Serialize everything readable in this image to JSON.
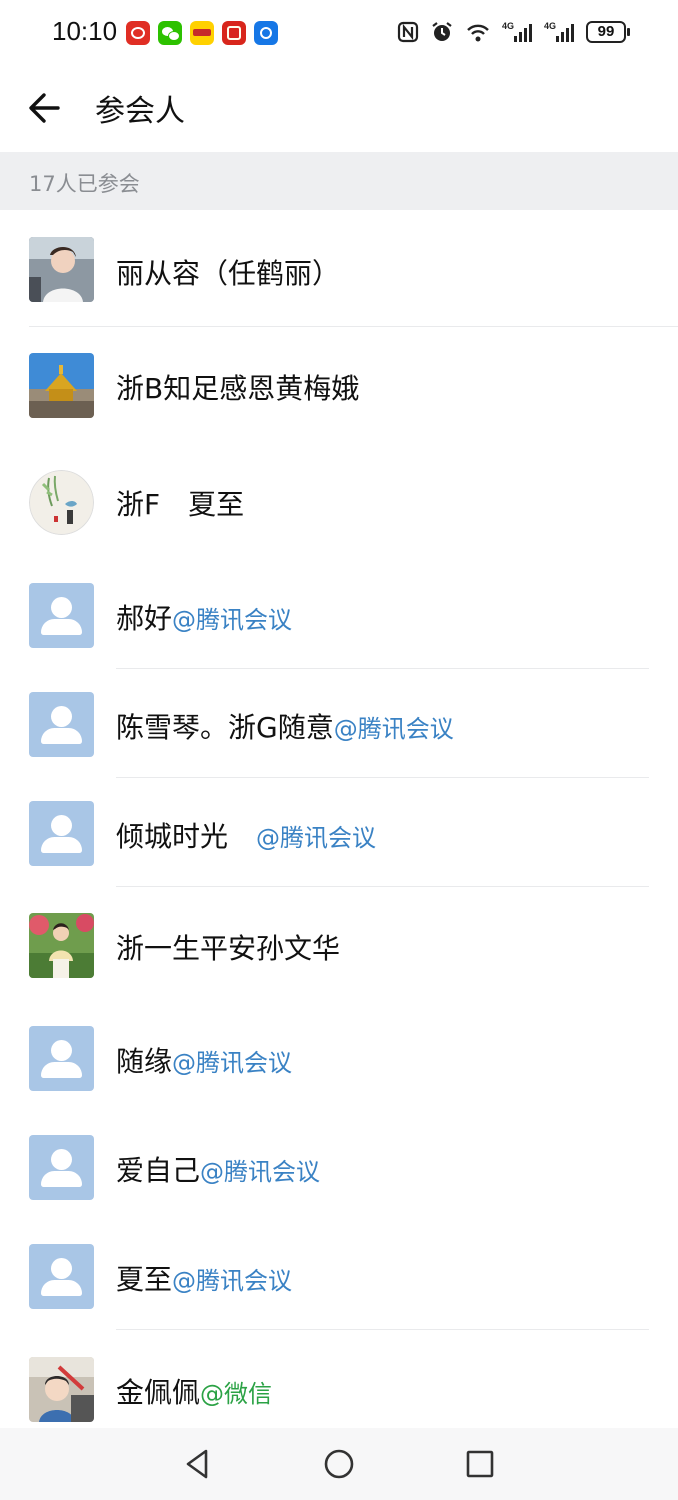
{
  "status_bar": {
    "time": "10:10",
    "battery": "99",
    "notification_icons": [
      "pinduoduo-icon",
      "wechat-icon",
      "meituan-icon",
      "taobao-icon",
      "browser-icon"
    ],
    "system_icons": [
      "nfc-icon",
      "alarm-icon",
      "wifi-icon",
      "signal-4g-icon",
      "signal-4g-icon"
    ]
  },
  "header": {
    "title": "参会人"
  },
  "summary": {
    "count_text": "17人已参会"
  },
  "participants": [
    {
      "name": "丽从容（任鹤丽）",
      "suffix": "",
      "avatar": "photo-woman-car"
    },
    {
      "name": "浙B知足感恩黄梅娥",
      "suffix": "",
      "avatar": "photo-golden-pavilion"
    },
    {
      "name": "浙F　夏至",
      "suffix": "",
      "avatar": "painting-bird-round"
    },
    {
      "name": "郝好",
      "suffix": "@腾讯会议",
      "avatar": "default"
    },
    {
      "name": "陈雪琴。浙G随意",
      "suffix": "@腾讯会议",
      "avatar": "default"
    },
    {
      "name": "倾城时光　",
      "suffix": "@腾讯会议",
      "avatar": "default"
    },
    {
      "name": "浙一生平安孙文华",
      "suffix": "",
      "avatar": "photo-woman-garden"
    },
    {
      "name": "随缘",
      "suffix": "@腾讯会议",
      "avatar": "default"
    },
    {
      "name": "爱自己",
      "suffix": "@腾讯会议",
      "avatar": "default"
    },
    {
      "name": "夏至",
      "suffix": "@腾讯会议",
      "avatar": "default"
    },
    {
      "name": "金佩佩",
      "suffix": "@微信",
      "avatar": "photo-child"
    }
  ],
  "colors": {
    "tencent_meeting_suffix": "#3a82c4",
    "wechat_suffix": "#2ba245",
    "default_avatar": "#a9c6e6",
    "count_bar_bg": "#eeeff1"
  },
  "nav_bar": {
    "buttons": [
      "back-triangle-icon",
      "home-circle-icon",
      "recents-square-icon"
    ]
  }
}
